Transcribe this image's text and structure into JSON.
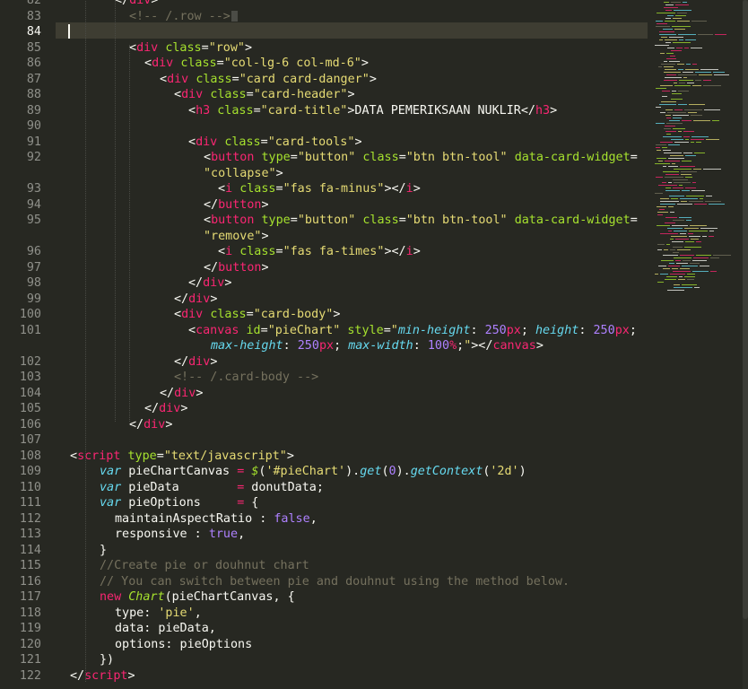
{
  "editor": {
    "active_line": 84,
    "lines": [
      {
        "num": "82",
        "indent": 128,
        "tokens": [
          {
            "c": "p",
            "t": "</"
          },
          {
            "c": "t",
            "t": "div"
          },
          {
            "c": "p",
            "t": ">"
          }
        ]
      },
      {
        "num": "83",
        "indent": 144,
        "tokens": [
          {
            "c": "c",
            "t": "<!-- /.row -->"
          }
        ],
        "boxchar": true
      },
      {
        "num": "84",
        "indent": 78,
        "tokens": [],
        "cursor": true
      },
      {
        "num": "85",
        "indent": 144,
        "tokens": [
          {
            "c": "p",
            "t": "<"
          },
          {
            "c": "t",
            "t": "div"
          },
          {
            "c": "p",
            "t": " "
          },
          {
            "c": "a",
            "t": "class"
          },
          {
            "c": "p",
            "t": "="
          },
          {
            "c": "s",
            "t": "\"row\""
          },
          {
            "c": "p",
            "t": ">"
          }
        ]
      },
      {
        "num": "86",
        "indent": 161,
        "tokens": [
          {
            "c": "p",
            "t": "<"
          },
          {
            "c": "t",
            "t": "div"
          },
          {
            "c": "p",
            "t": " "
          },
          {
            "c": "a",
            "t": "class"
          },
          {
            "c": "p",
            "t": "="
          },
          {
            "c": "s",
            "t": "\"col-lg-6 col-md-6\""
          },
          {
            "c": "p",
            "t": ">"
          }
        ]
      },
      {
        "num": "87",
        "indent": 178,
        "tokens": [
          {
            "c": "p",
            "t": "<"
          },
          {
            "c": "t",
            "t": "div"
          },
          {
            "c": "p",
            "t": " "
          },
          {
            "c": "a",
            "t": "class"
          },
          {
            "c": "p",
            "t": "="
          },
          {
            "c": "s",
            "t": "\"card card-danger\""
          },
          {
            "c": "p",
            "t": ">"
          }
        ]
      },
      {
        "num": "88",
        "indent": 194,
        "tokens": [
          {
            "c": "p",
            "t": "<"
          },
          {
            "c": "t",
            "t": "div"
          },
          {
            "c": "p",
            "t": " "
          },
          {
            "c": "a",
            "t": "class"
          },
          {
            "c": "p",
            "t": "="
          },
          {
            "c": "s",
            "t": "\"card-header\""
          },
          {
            "c": "p",
            "t": ">"
          }
        ]
      },
      {
        "num": "89",
        "indent": 210,
        "tokens": [
          {
            "c": "p",
            "t": "<"
          },
          {
            "c": "t",
            "t": "h3"
          },
          {
            "c": "p",
            "t": " "
          },
          {
            "c": "a",
            "t": "class"
          },
          {
            "c": "p",
            "t": "="
          },
          {
            "c": "s",
            "t": "\"card-title\""
          },
          {
            "c": "p",
            "t": ">DATA PEMERIKSAAN NUKLIR</"
          },
          {
            "c": "t",
            "t": "h3"
          },
          {
            "c": "p",
            "t": ">"
          }
        ]
      },
      {
        "num": "90",
        "indent": 210,
        "tokens": []
      },
      {
        "num": "91",
        "indent": 210,
        "tokens": [
          {
            "c": "p",
            "t": "<"
          },
          {
            "c": "t",
            "t": "div"
          },
          {
            "c": "p",
            "t": " "
          },
          {
            "c": "a",
            "t": "class"
          },
          {
            "c": "p",
            "t": "="
          },
          {
            "c": "s",
            "t": "\"card-tools\""
          },
          {
            "c": "p",
            "t": ">"
          }
        ]
      },
      {
        "num": "92",
        "indent": 227,
        "tokens": [
          {
            "c": "p",
            "t": "<"
          },
          {
            "c": "t",
            "t": "button"
          },
          {
            "c": "p",
            "t": " "
          },
          {
            "c": "a",
            "t": "type"
          },
          {
            "c": "p",
            "t": "="
          },
          {
            "c": "s",
            "t": "\"button\""
          },
          {
            "c": "p",
            "t": " "
          },
          {
            "c": "a",
            "t": "class"
          },
          {
            "c": "p",
            "t": "="
          },
          {
            "c": "s",
            "t": "\"btn btn-tool\""
          },
          {
            "c": "p",
            "t": " "
          },
          {
            "c": "a",
            "t": "data-card-widget"
          },
          {
            "c": "p",
            "t": "="
          }
        ]
      },
      {
        "num": "",
        "indent": 227,
        "tokens": [
          {
            "c": "s",
            "t": "\"collapse\""
          },
          {
            "c": "p",
            "t": ">"
          }
        ]
      },
      {
        "num": "93",
        "indent": 243,
        "tokens": [
          {
            "c": "p",
            "t": "<"
          },
          {
            "c": "t",
            "t": "i"
          },
          {
            "c": "p",
            "t": " "
          },
          {
            "c": "a",
            "t": "class"
          },
          {
            "c": "p",
            "t": "="
          },
          {
            "c": "s",
            "t": "\"fas fa-minus\""
          },
          {
            "c": "p",
            "t": "></"
          },
          {
            "c": "t",
            "t": "i"
          },
          {
            "c": "p",
            "t": ">"
          }
        ]
      },
      {
        "num": "94",
        "indent": 227,
        "tokens": [
          {
            "c": "p",
            "t": "</"
          },
          {
            "c": "t",
            "t": "button"
          },
          {
            "c": "p",
            "t": ">"
          }
        ]
      },
      {
        "num": "95",
        "indent": 227,
        "tokens": [
          {
            "c": "p",
            "t": "<"
          },
          {
            "c": "t",
            "t": "button"
          },
          {
            "c": "p",
            "t": " "
          },
          {
            "c": "a",
            "t": "type"
          },
          {
            "c": "p",
            "t": "="
          },
          {
            "c": "s",
            "t": "\"button\""
          },
          {
            "c": "p",
            "t": " "
          },
          {
            "c": "a",
            "t": "class"
          },
          {
            "c": "p",
            "t": "="
          },
          {
            "c": "s",
            "t": "\"btn btn-tool\""
          },
          {
            "c": "p",
            "t": " "
          },
          {
            "c": "a",
            "t": "data-card-widget"
          },
          {
            "c": "p",
            "t": "="
          }
        ]
      },
      {
        "num": "",
        "indent": 227,
        "tokens": [
          {
            "c": "s",
            "t": "\"remove\""
          },
          {
            "c": "p",
            "t": ">"
          }
        ]
      },
      {
        "num": "96",
        "indent": 243,
        "tokens": [
          {
            "c": "p",
            "t": "<"
          },
          {
            "c": "t",
            "t": "i"
          },
          {
            "c": "p",
            "t": " "
          },
          {
            "c": "a",
            "t": "class"
          },
          {
            "c": "p",
            "t": "="
          },
          {
            "c": "s",
            "t": "\"fas fa-times\""
          },
          {
            "c": "p",
            "t": "></"
          },
          {
            "c": "t",
            "t": "i"
          },
          {
            "c": "p",
            "t": ">"
          }
        ]
      },
      {
        "num": "97",
        "indent": 227,
        "tokens": [
          {
            "c": "p",
            "t": "</"
          },
          {
            "c": "t",
            "t": "button"
          },
          {
            "c": "p",
            "t": ">"
          }
        ]
      },
      {
        "num": "98",
        "indent": 210,
        "tokens": [
          {
            "c": "p",
            "t": "</"
          },
          {
            "c": "t",
            "t": "div"
          },
          {
            "c": "p",
            "t": ">"
          }
        ]
      },
      {
        "num": "99",
        "indent": 194,
        "tokens": [
          {
            "c": "p",
            "t": "</"
          },
          {
            "c": "t",
            "t": "div"
          },
          {
            "c": "p",
            "t": ">"
          }
        ]
      },
      {
        "num": "100",
        "indent": 194,
        "tokens": [
          {
            "c": "p",
            "t": "<"
          },
          {
            "c": "t",
            "t": "div"
          },
          {
            "c": "p",
            "t": " "
          },
          {
            "c": "a",
            "t": "class"
          },
          {
            "c": "p",
            "t": "="
          },
          {
            "c": "s",
            "t": "\"card-body\""
          },
          {
            "c": "p",
            "t": ">"
          }
        ]
      },
      {
        "num": "101",
        "indent": 210,
        "tokens": [
          {
            "c": "p",
            "t": "<"
          },
          {
            "c": "t",
            "t": "canvas"
          },
          {
            "c": "p",
            "t": " "
          },
          {
            "c": "a",
            "t": "id"
          },
          {
            "c": "p",
            "t": "="
          },
          {
            "c": "s",
            "t": "\"pieChart\""
          },
          {
            "c": "p",
            "t": " "
          },
          {
            "c": "a",
            "t": "style"
          },
          {
            "c": "p",
            "t": "="
          },
          {
            "c": "s",
            "t": "\""
          },
          {
            "c": "k",
            "t": "min-height"
          },
          {
            "c": "p",
            "t": ": "
          },
          {
            "c": "n",
            "t": "250"
          },
          {
            "c": "t",
            "t": "px"
          },
          {
            "c": "p",
            "t": "; "
          },
          {
            "c": "k",
            "t": "height"
          },
          {
            "c": "p",
            "t": ": "
          },
          {
            "c": "n",
            "t": "250"
          },
          {
            "c": "t",
            "t": "px"
          },
          {
            "c": "p",
            "t": ";"
          }
        ]
      },
      {
        "num": "",
        "indent": 235,
        "tokens": [
          {
            "c": "k",
            "t": "max-height"
          },
          {
            "c": "p",
            "t": ": "
          },
          {
            "c": "n",
            "t": "250"
          },
          {
            "c": "t",
            "t": "px"
          },
          {
            "c": "p",
            "t": "; "
          },
          {
            "c": "k",
            "t": "max-width"
          },
          {
            "c": "p",
            "t": ": "
          },
          {
            "c": "n",
            "t": "100"
          },
          {
            "c": "t",
            "t": "%"
          },
          {
            "c": "p",
            "t": ";"
          },
          {
            "c": "s",
            "t": "\""
          },
          {
            "c": "p",
            "t": "></"
          },
          {
            "c": "t",
            "t": "canvas"
          },
          {
            "c": "p",
            "t": ">"
          }
        ]
      },
      {
        "num": "102",
        "indent": 194,
        "tokens": [
          {
            "c": "p",
            "t": "</"
          },
          {
            "c": "t",
            "t": "div"
          },
          {
            "c": "p",
            "t": ">"
          }
        ]
      },
      {
        "num": "103",
        "indent": 194,
        "tokens": [
          {
            "c": "c",
            "t": "<!-- /.card-body -->"
          }
        ]
      },
      {
        "num": "104",
        "indent": 178,
        "tokens": [
          {
            "c": "p",
            "t": "</"
          },
          {
            "c": "t",
            "t": "div"
          },
          {
            "c": "p",
            "t": ">"
          }
        ]
      },
      {
        "num": "105",
        "indent": 161,
        "tokens": [
          {
            "c": "p",
            "t": "</"
          },
          {
            "c": "t",
            "t": "div"
          },
          {
            "c": "p",
            "t": ">"
          }
        ]
      },
      {
        "num": "106",
        "indent": 144,
        "tokens": [
          {
            "c": "p",
            "t": "</"
          },
          {
            "c": "t",
            "t": "div"
          },
          {
            "c": "p",
            "t": ">"
          }
        ]
      },
      {
        "num": "107",
        "indent": 78,
        "tokens": []
      },
      {
        "num": "108",
        "indent": 78,
        "tokens": [
          {
            "c": "p",
            "t": "<"
          },
          {
            "c": "t",
            "t": "script"
          },
          {
            "c": "p",
            "t": " "
          },
          {
            "c": "a",
            "t": "type"
          },
          {
            "c": "p",
            "t": "="
          },
          {
            "c": "s",
            "t": "\"text/javascript\""
          },
          {
            "c": "p",
            "t": ">"
          }
        ]
      },
      {
        "num": "109",
        "indent": 111,
        "tokens": [
          {
            "c": "k",
            "t": "var"
          },
          {
            "c": "p",
            "t": " pieChartCanvas "
          },
          {
            "c": "t",
            "t": "="
          },
          {
            "c": "p",
            "t": " "
          },
          {
            "c": "pi",
            "t": "$"
          },
          {
            "c": "p",
            "t": "("
          },
          {
            "c": "s",
            "t": "'#pieChart'"
          },
          {
            "c": "p",
            "t": ")."
          },
          {
            "c": "k",
            "t": "get"
          },
          {
            "c": "p",
            "t": "("
          },
          {
            "c": "n",
            "t": "0"
          },
          {
            "c": "p",
            "t": ")."
          },
          {
            "c": "k",
            "t": "getContext"
          },
          {
            "c": "p",
            "t": "("
          },
          {
            "c": "s",
            "t": "'2d'"
          },
          {
            "c": "p",
            "t": ")"
          }
        ]
      },
      {
        "num": "110",
        "indent": 111,
        "tokens": [
          {
            "c": "k",
            "t": "var"
          },
          {
            "c": "p",
            "t": " pieData        "
          },
          {
            "c": "t",
            "t": "="
          },
          {
            "c": "p",
            "t": " donutData;"
          }
        ]
      },
      {
        "num": "111",
        "indent": 111,
        "tokens": [
          {
            "c": "k",
            "t": "var"
          },
          {
            "c": "p",
            "t": " pieOptions     "
          },
          {
            "c": "t",
            "t": "="
          },
          {
            "c": "p",
            "t": " {"
          }
        ]
      },
      {
        "num": "112",
        "indent": 128,
        "tokens": [
          {
            "c": "p",
            "t": "maintainAspectRatio : "
          },
          {
            "c": "n",
            "t": "false"
          },
          {
            "c": "p",
            "t": ","
          }
        ]
      },
      {
        "num": "113",
        "indent": 128,
        "tokens": [
          {
            "c": "p",
            "t": "responsive : "
          },
          {
            "c": "n",
            "t": "true"
          },
          {
            "c": "p",
            "t": ","
          }
        ]
      },
      {
        "num": "114",
        "indent": 111,
        "tokens": [
          {
            "c": "p",
            "t": "}"
          }
        ]
      },
      {
        "num": "115",
        "indent": 111,
        "tokens": [
          {
            "c": "c",
            "t": "//Create pie or douhnut chart"
          }
        ]
      },
      {
        "num": "116",
        "indent": 111,
        "tokens": [
          {
            "c": "c",
            "t": "// You can switch between pie and douhnut using the method below."
          }
        ]
      },
      {
        "num": "117",
        "indent": 111,
        "tokens": [
          {
            "c": "t",
            "t": "new"
          },
          {
            "c": "p",
            "t": " "
          },
          {
            "c": "pi",
            "t": "Chart"
          },
          {
            "c": "p",
            "t": "(pieChartCanvas, {"
          }
        ]
      },
      {
        "num": "118",
        "indent": 128,
        "tokens": [
          {
            "c": "p",
            "t": "type: "
          },
          {
            "c": "s",
            "t": "'pie'"
          },
          {
            "c": "p",
            "t": ","
          }
        ]
      },
      {
        "num": "119",
        "indent": 128,
        "tokens": [
          {
            "c": "p",
            "t": "data: pieData,"
          }
        ]
      },
      {
        "num": "120",
        "indent": 128,
        "tokens": [
          {
            "c": "p",
            "t": "options: pieOptions"
          }
        ]
      },
      {
        "num": "121",
        "indent": 111,
        "tokens": [
          {
            "c": "p",
            "t": "})"
          }
        ]
      },
      {
        "num": "122",
        "indent": 78,
        "tokens": [
          {
            "c": "p",
            "t": "</"
          },
          {
            "c": "t",
            "t": "script"
          },
          {
            "c": "p",
            "t": ">"
          }
        ]
      }
    ]
  },
  "theme": {
    "background": "#272822",
    "active_line_bg": "#3e3d32",
    "tag": "#f92672",
    "attribute": "#a6e22e",
    "string": "#e6db74",
    "comment": "#75715e",
    "keyword": "#66d9ef",
    "number": "#ae81ff",
    "gutter_text": "#8f908a"
  }
}
